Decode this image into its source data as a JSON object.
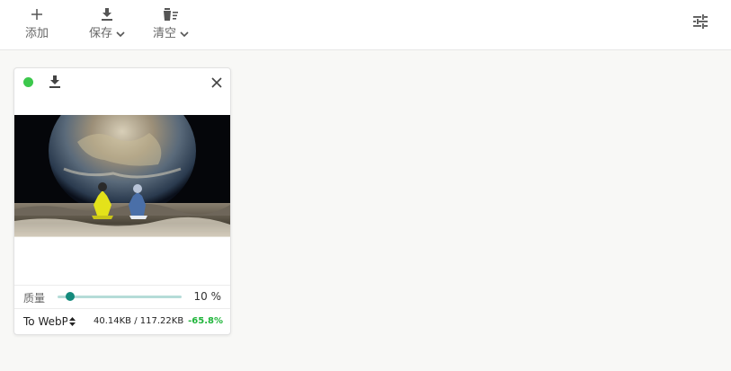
{
  "toolbar": {
    "add_label": "添加",
    "save_label": "保存",
    "clear_label": "清空"
  },
  "cards": [
    {
      "status": "done",
      "status_color": "#3cc84c",
      "quality_label": "质量",
      "quality_value": "10 %",
      "quality_fraction": 0.1,
      "format": "To WebP",
      "size_text": "40.14KB / 117.22KB",
      "ratio_text": "-65.8%",
      "ratio_color": "#1fb53a"
    }
  ],
  "colors": {
    "accent": "#138a7c",
    "track": "#b5dcd8",
    "success": "#3cc84c"
  },
  "icons": {
    "add": "plus-icon",
    "save": "download-icon",
    "clear": "trash-icon",
    "settings": "sliders-icon",
    "close": "close-icon"
  }
}
